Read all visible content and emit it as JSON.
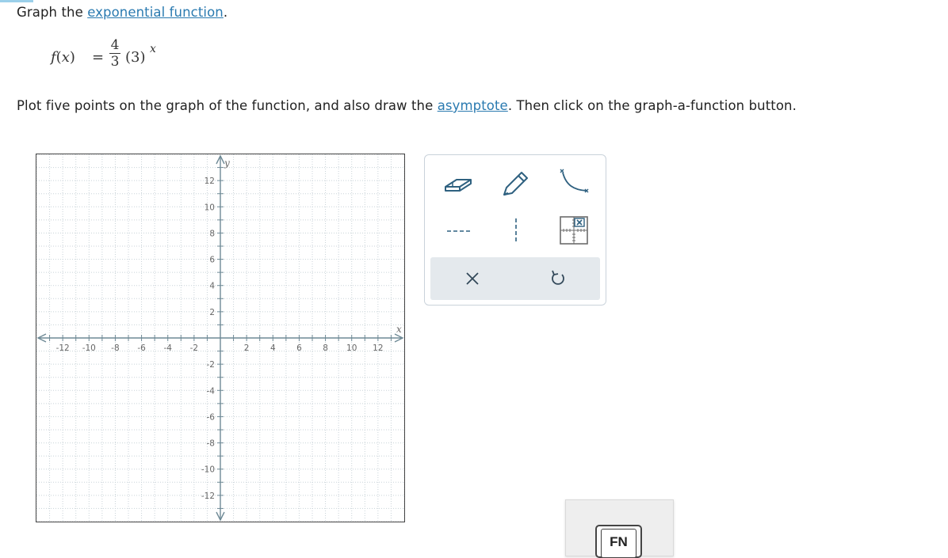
{
  "prompt": {
    "prefix": "Graph the ",
    "link": "exponential function",
    "suffix": "."
  },
  "formula": {
    "lhs_f": "f",
    "lhs_open": "(",
    "lhs_x": "x",
    "lhs_close": ")",
    "equals": "=",
    "numerator": "4",
    "denominator": "3",
    "base": "(3)",
    "exponent": "x"
  },
  "instruction": {
    "prefix": "Plot five points on the graph of the function, and also draw the ",
    "link": "asymptote",
    "suffix": ". Then click on the graph-a-function button."
  },
  "graph": {
    "x_axis_label": "x",
    "y_axis_label": "y",
    "x_ticks": [
      "-12",
      "-10",
      "-8",
      "-6",
      "-4",
      "-2",
      "2",
      "4",
      "6",
      "8",
      "10",
      "12"
    ],
    "x_tick_values": [
      -12,
      -10,
      -8,
      -6,
      -4,
      -2,
      2,
      4,
      6,
      8,
      10,
      12
    ],
    "y_ticks": [
      "12",
      "10",
      "8",
      "6",
      "4",
      "2",
      "-2",
      "-4",
      "-6",
      "-8",
      "-10",
      "-12"
    ],
    "y_tick_values": [
      12,
      10,
      8,
      6,
      4,
      2,
      -2,
      -4,
      -6,
      -8,
      -10,
      -12
    ],
    "xlim": [
      -14,
      14
    ],
    "ylim": [
      -14,
      14
    ],
    "grid": true,
    "grid_step": 1
  },
  "toolbox": {
    "tools": [
      {
        "name": "eraser",
        "icon": "eraser-icon"
      },
      {
        "name": "pencil",
        "icon": "pencil-icon"
      },
      {
        "name": "exponential-curve",
        "icon": "curve-icon"
      },
      {
        "name": "horizontal-dashed-line",
        "icon": "dashed-horizontal-line-icon"
      },
      {
        "name": "vertical-dashed-line",
        "icon": "dashed-vertical-line-icon"
      },
      {
        "name": "graph-function",
        "icon": "graph-grid-icon"
      }
    ],
    "actions": [
      {
        "name": "clear",
        "icon": "close-icon",
        "glyph": "✕"
      },
      {
        "name": "undo",
        "icon": "undo-icon"
      }
    ]
  },
  "fn_button": {
    "label": "FN"
  },
  "colors": {
    "link": "#2a7ab0",
    "axis": "#6f8a96",
    "grid": "#c8d2d8",
    "tool_stroke": "#2f6180",
    "action_bg": "#e4e9ed"
  }
}
